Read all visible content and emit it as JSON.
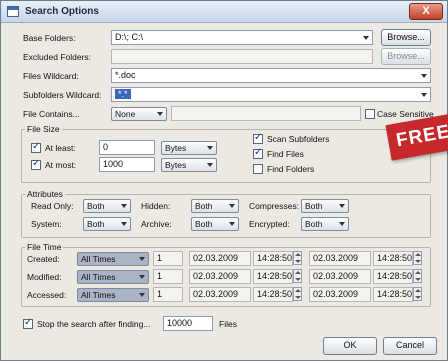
{
  "window": {
    "title": "Search Options",
    "close_glyph": "X"
  },
  "base_folders": {
    "label": "Base Folders:",
    "value": "D:\\; C:\\",
    "browse": "Browse..."
  },
  "excluded_folders": {
    "label": "Excluded Folders:",
    "value": "",
    "browse": "Browse..."
  },
  "files_wildcard": {
    "label": "Files Wildcard:",
    "value": "*.doc"
  },
  "subfolders_wildcard": {
    "label": "Subfolders Wildcard:",
    "value": "*.*"
  },
  "file_contains": {
    "label": "File Contains...",
    "mode": "None",
    "value": "",
    "case_sensitive": "Case Sensitive"
  },
  "file_size": {
    "title": "File Size",
    "at_least": {
      "label": "At least:",
      "value": "0",
      "unit": "Bytes"
    },
    "at_most": {
      "label": "At most:",
      "value": "1000",
      "unit": "Bytes"
    },
    "scan_subfolders": "Scan Subfolders",
    "find_files": "Find Files",
    "find_folders": "Find Folders"
  },
  "attributes": {
    "title": "Attributes",
    "read_only": {
      "label": "Read Only:",
      "value": "Both"
    },
    "hidden": {
      "label": "Hidden:",
      "value": "Both"
    },
    "compressed": {
      "label": "Compresses:",
      "value": "Both"
    },
    "system": {
      "label": "System:",
      "value": "Both"
    },
    "archive": {
      "label": "Archive:",
      "value": "Both"
    },
    "encrypted": {
      "label": "Encrypted:",
      "value": "Both"
    }
  },
  "file_time": {
    "title": "File Time",
    "rows": [
      {
        "label": "Created:",
        "mode": "All Times",
        "num": "1",
        "date1": "02.03.2009",
        "time1": "14:28:50",
        "date2": "02.03.2009",
        "time2": "14:28:50"
      },
      {
        "label": "Modified:",
        "mode": "All Times",
        "num": "1",
        "date1": "02.03.2009",
        "time1": "14:28:50",
        "date2": "02.03.2009",
        "time2": "14:28:50"
      },
      {
        "label": "Accessed:",
        "mode": "All Times",
        "num": "1",
        "date1": "02.03.2009",
        "time1": "14:28:50",
        "date2": "02.03.2009",
        "time2": "14:28:50"
      }
    ]
  },
  "stop_search": {
    "label": "Stop the search after finding...",
    "value": "10000",
    "suffix": "Files"
  },
  "buttons": {
    "ok": "OK",
    "cancel": "Cancel"
  },
  "overlay": {
    "banner": "FREE",
    "banner_color": "#c6282b"
  }
}
